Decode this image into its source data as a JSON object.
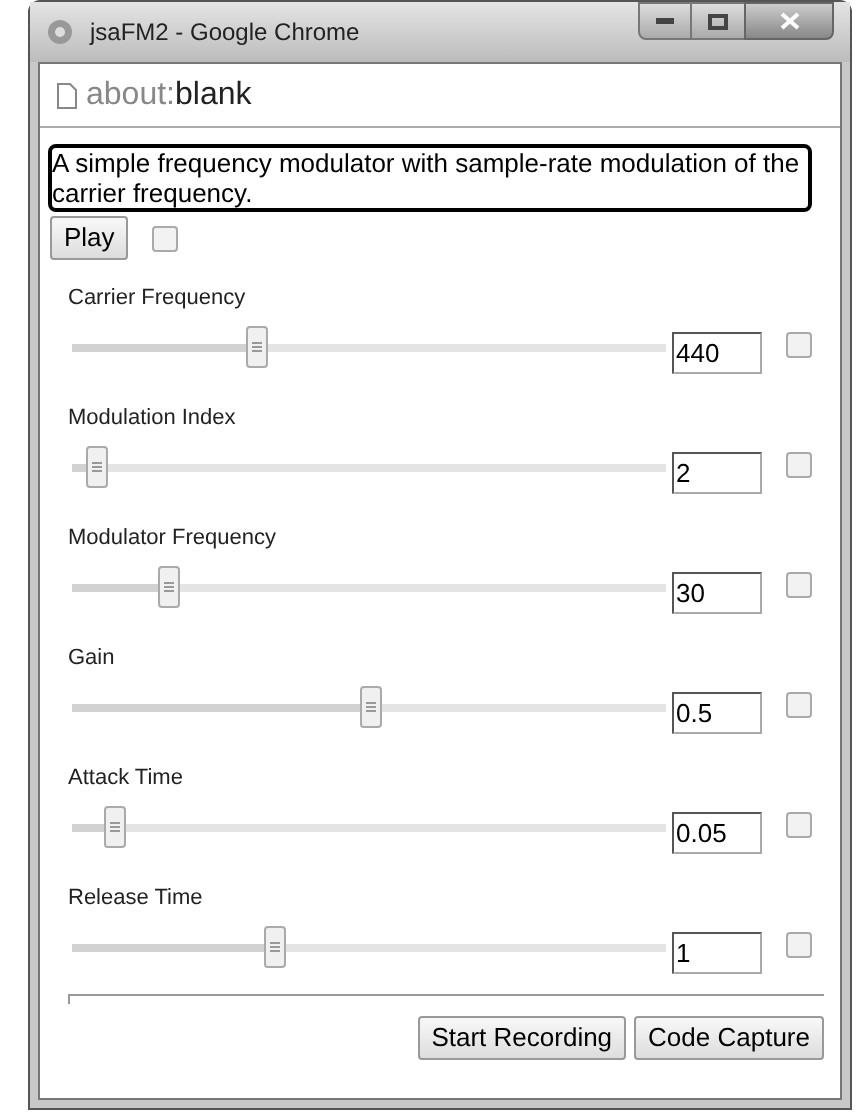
{
  "window": {
    "title": "jsaFM2 - Google Chrome"
  },
  "address_bar": {
    "prefix": "about:",
    "page": "blank"
  },
  "description": "A simple frequency modulator with sample-rate modulation of the carrier frequency.",
  "play": {
    "label": "Play",
    "checked": false
  },
  "controls": [
    {
      "label": "Carrier Frequency",
      "level": 0.31,
      "value": "440",
      "checked": false
    },
    {
      "label": "Modulation Index",
      "level": 0.04,
      "value": "2",
      "checked": false
    },
    {
      "label": "Modulator Frequency",
      "level": 0.16,
      "value": "30",
      "checked": false
    },
    {
      "label": "Gain",
      "level": 0.5,
      "value": "0.5",
      "checked": false
    },
    {
      "label": "Attack Time",
      "level": 0.07,
      "value": "0.05",
      "checked": false
    },
    {
      "label": "Release Time",
      "level": 0.34,
      "value": "1",
      "checked": false
    }
  ],
  "buttons": [
    "Start Recording",
    "Code Capture"
  ]
}
